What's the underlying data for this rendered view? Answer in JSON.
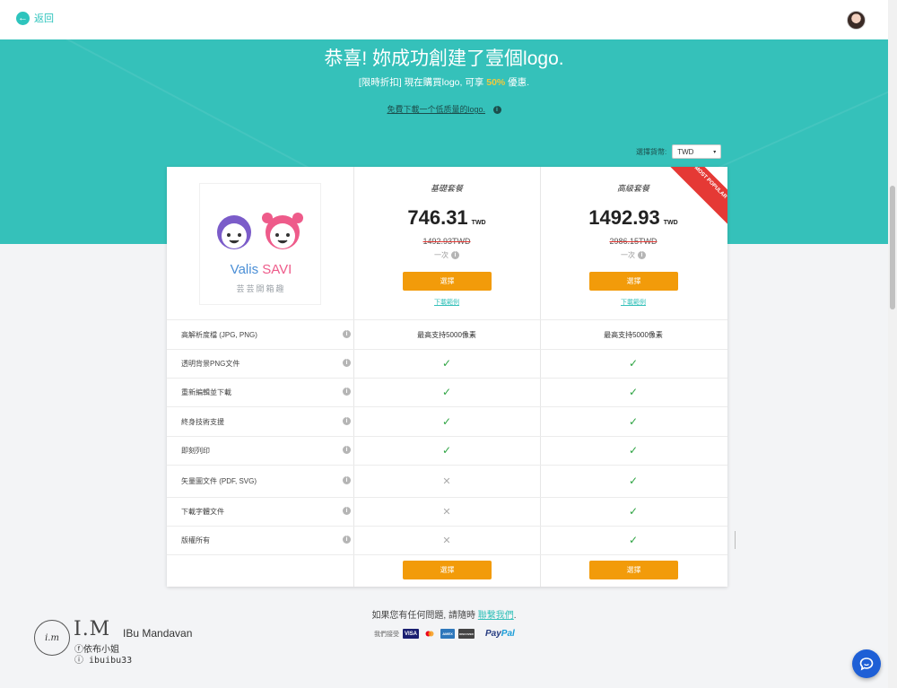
{
  "header": {
    "back_label": "返回"
  },
  "hero": {
    "title": "恭喜! 妳成功創建了壹個logo.",
    "subtitle_prefix": "[限時折扣] 現在購買logo, 可享 ",
    "subtitle_discount": "50%",
    "subtitle_suffix": " 優惠.",
    "free_download": "免費下載一个低质量的logo.",
    "currency_label": "選擇貨幣:",
    "currency_value": "TWD"
  },
  "logo": {
    "name_part1": "Valis ",
    "name_part2": "SAVI",
    "subtitle": "芸芸開箱趣"
  },
  "plans": [
    {
      "name": "基礎套餐",
      "price": "746.31",
      "currency": "TWD",
      "old_price": "1492.93TWD",
      "period": "一次",
      "button": "選擇",
      "sample": "下載範例"
    },
    {
      "name": "高級套餐",
      "price": "1492.93",
      "currency": "TWD",
      "old_price": "2986.15TWD",
      "period": "一次",
      "button": "選擇",
      "sample": "下載範例",
      "badge": "MOST POPULAR"
    }
  ],
  "features": [
    {
      "label": "高解析度檔 (JPG, PNG)",
      "basic": "最高支持5000像素",
      "premium": "最高支持5000像素"
    },
    {
      "label": "透明背景PNG文件",
      "basic": "check",
      "premium": "check"
    },
    {
      "label": "重新編輯並下載",
      "basic": "check",
      "premium": "check"
    },
    {
      "label": "終身技術支援",
      "basic": "check",
      "premium": "check"
    },
    {
      "label": "即刻列印",
      "basic": "check",
      "premium": "check"
    },
    {
      "label": "矢量圖文件 (PDF, SVG)",
      "basic": "cross",
      "premium": "check"
    },
    {
      "label": "下載字體文件",
      "basic": "cross",
      "premium": "check"
    },
    {
      "label": "版權所有",
      "basic": "cross",
      "premium": "check"
    }
  ],
  "footer_buttons": [
    "選擇",
    "選擇"
  ],
  "help": {
    "prefix": "如果您有任何問題, 請隨時 ",
    "link": "聯繫我們",
    "suffix": "."
  },
  "payments": {
    "label": "我們接受",
    "methods": [
      "VISA",
      "MC",
      "AMEX",
      "DISCOVER"
    ],
    "paypal_1": "Pay",
    "paypal_2": "Pal"
  },
  "watermark": {
    "mark": "i.m",
    "title": "I.M",
    "name": "IBu Mandavan",
    "fb": "ⓕ依布小姐",
    "ig": "ⓘ ibuibu33"
  },
  "colors": {
    "teal": "#35c1ba",
    "orange": "#f29b0a",
    "red": "#e53935",
    "check": "#2ea443"
  }
}
